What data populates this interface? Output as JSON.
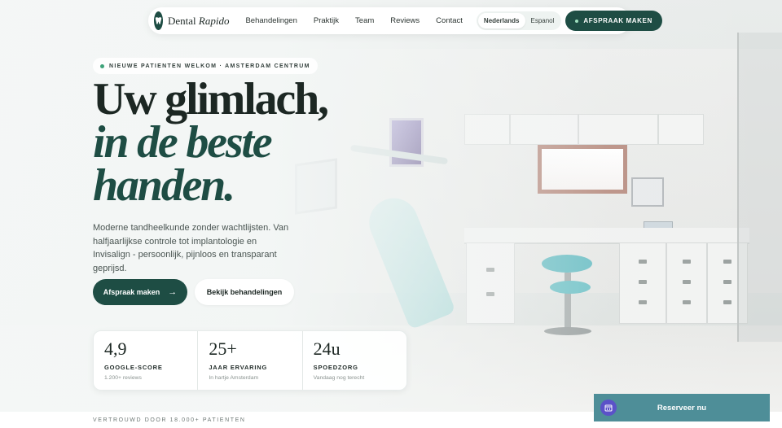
{
  "nav": {
    "brand_main": "Dental",
    "brand_italic": "Rapido",
    "links": [
      "Behandelingen",
      "Praktijk",
      "Team",
      "Reviews",
      "Contact"
    ],
    "languages": [
      "Nederlands",
      "Espanol"
    ],
    "active_language": "Nederlands",
    "cta": "AFSPRAAK MAKEN"
  },
  "hero": {
    "badge": "NIEUWE PATIENTEN WELKOM · AMSTERDAM CENTRUM",
    "headline_1": "Uw glimlach,",
    "headline_2": "in de beste",
    "headline_3": "handen.",
    "lead": "Moderne tandheelkunde zonder wachtlijsten. Van halfjaarlijkse controle tot implantologie en Invisalign - persoonlijk, pijnloos en transparant geprijsd.",
    "primary_button": "Afspraak maken",
    "secondary_button": "Bekijk behandelingen"
  },
  "stats": [
    {
      "value": "4,9",
      "label": "GOOGLE-SCORE",
      "sub": "1.200+ reviews"
    },
    {
      "value": "25+",
      "label": "JAAR ERVARING",
      "sub": "In hartje Amsterdam"
    },
    {
      "value": "24u",
      "label": "SPOEDZORG",
      "sub": "Vandaag nog terecht"
    }
  ],
  "trusted": "VERTROUWD DOOR 18.000+ PATIENTEN",
  "reserve": {
    "label": "Reserveer nu"
  },
  "icons": {
    "logo": "tooth-icon",
    "cta_dot": "status-dot-icon",
    "arrow": "arrow-right-icon",
    "reserve": "calendar-icon"
  },
  "colors": {
    "brand_green": "#1e4d44",
    "accent_dot": "#3fa37a",
    "reserve_bg": "#4e8e98",
    "reserve_icon_bg": "#5b52c8"
  }
}
